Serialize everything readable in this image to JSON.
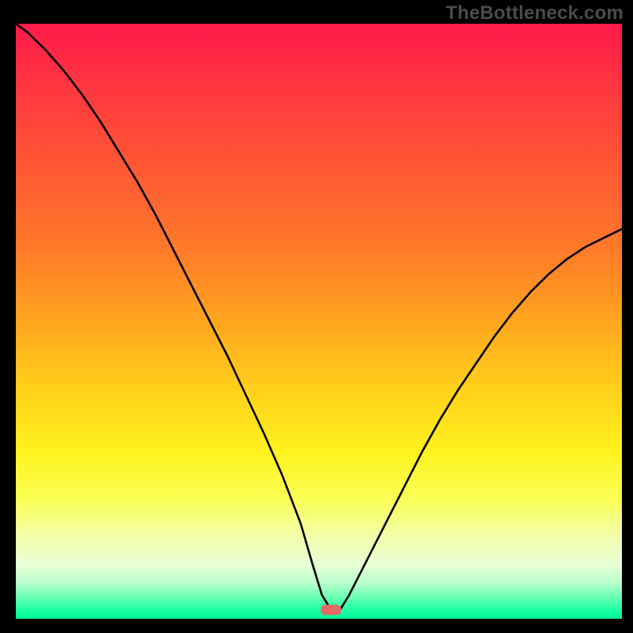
{
  "watermark": "TheBottleneck.com",
  "colors": {
    "background_black": "#000000",
    "curve_stroke": "#000000",
    "marker_fill": "#e46a66",
    "gradient_stops": [
      {
        "offset": 0.0,
        "color": "#ff1a4b"
      },
      {
        "offset": 0.12,
        "color": "#ff3a3f"
      },
      {
        "offset": 0.25,
        "color": "#ff5a33"
      },
      {
        "offset": 0.38,
        "color": "#ff7a28"
      },
      {
        "offset": 0.5,
        "color": "#ffa51f"
      },
      {
        "offset": 0.62,
        "color": "#ffd21a"
      },
      {
        "offset": 0.72,
        "color": "#fff21f"
      },
      {
        "offset": 0.8,
        "color": "#faff55"
      },
      {
        "offset": 0.86,
        "color": "#f2ffa8"
      },
      {
        "offset": 0.91,
        "color": "#e8ffd8"
      },
      {
        "offset": 0.94,
        "color": "#b8ffcc"
      },
      {
        "offset": 0.965,
        "color": "#66ffb3"
      },
      {
        "offset": 0.985,
        "color": "#1effa4"
      },
      {
        "offset": 1.0,
        "color": "#00f59a"
      }
    ]
  },
  "chart_data": {
    "type": "line",
    "title": "",
    "xlabel": "",
    "ylabel": "",
    "xlim": [
      0,
      100
    ],
    "ylim": [
      0,
      100
    ],
    "marker": {
      "x": 52,
      "y": 1.5
    },
    "x": [
      0,
      2,
      5,
      8,
      11,
      14,
      17,
      20,
      23,
      26,
      29,
      32,
      35,
      38,
      41,
      44,
      47,
      49,
      50.5,
      52,
      53.5,
      55,
      58,
      61,
      64,
      67,
      70,
      73,
      76,
      79,
      82,
      85,
      88,
      91,
      94,
      97,
      100
    ],
    "values": [
      100,
      98.5,
      95.5,
      92,
      88,
      83.5,
      78.5,
      73.5,
      68,
      62,
      56,
      50,
      44,
      37.5,
      31,
      24,
      16,
      9,
      4,
      1.5,
      1.5,
      4,
      10,
      16,
      22,
      28,
      33.5,
      38.5,
      43,
      47.5,
      51.5,
      55,
      58,
      60.5,
      62.5,
      64,
      65.5
    ]
  }
}
